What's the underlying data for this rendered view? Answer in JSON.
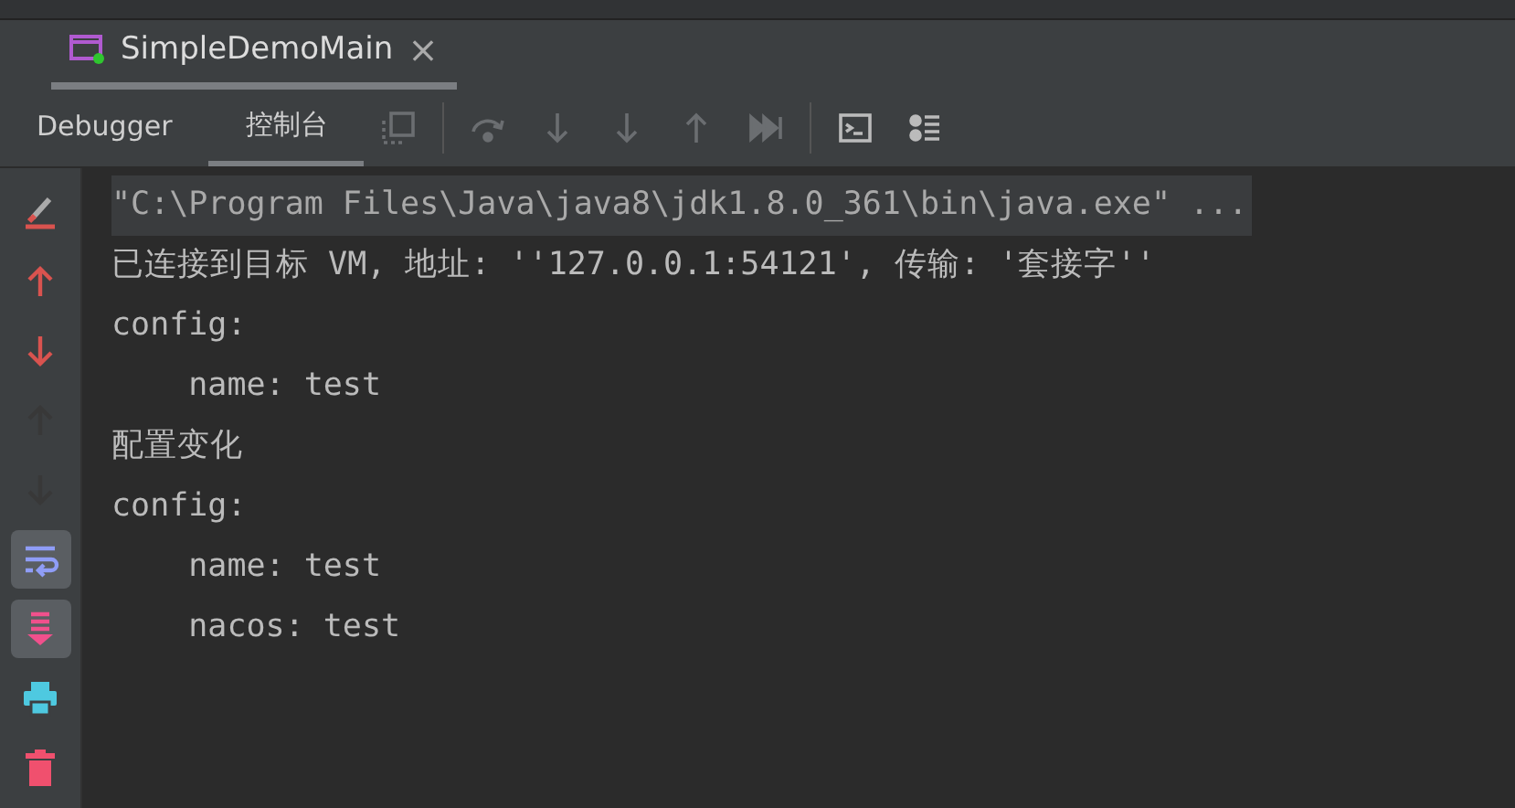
{
  "editor_tabs": [
    {
      "label": "SimpleDemoMain",
      "selected": true,
      "close": "×"
    }
  ],
  "panel_tabs": [
    {
      "label": "Debugger",
      "selected": false
    },
    {
      "label": "控制台",
      "selected": true
    }
  ],
  "toolbar": [
    {
      "kind": "layout",
      "disabled": true
    },
    {
      "kind": "sep"
    },
    {
      "kind": "step-over",
      "disabled": true
    },
    {
      "kind": "step-into",
      "disabled": true
    },
    {
      "kind": "force-step-into",
      "disabled": true
    },
    {
      "kind": "step-out",
      "disabled": true
    },
    {
      "kind": "run-to-cursor",
      "disabled": true
    },
    {
      "kind": "sep"
    },
    {
      "kind": "terminal",
      "disabled": false
    },
    {
      "kind": "list",
      "disabled": false
    }
  ],
  "sidebar": [
    {
      "kind": "clear",
      "disabled": false,
      "toggled": false
    },
    {
      "kind": "up",
      "disabled": false,
      "toggled": false
    },
    {
      "kind": "down",
      "disabled": false,
      "toggled": false
    },
    {
      "kind": "up",
      "disabled": true,
      "toggled": false
    },
    {
      "kind": "down",
      "disabled": true,
      "toggled": false
    },
    {
      "kind": "wrap",
      "disabled": false,
      "toggled": true
    },
    {
      "kind": "scroll",
      "disabled": false,
      "toggled": true
    },
    {
      "kind": "print",
      "disabled": false,
      "toggled": false
    },
    {
      "kind": "trash",
      "disabled": false,
      "toggled": false
    }
  ],
  "console": [
    {
      "kind": "command",
      "text": "\"C:\\Program Files\\Java\\java8\\jdk1.8.0_361\\bin\\java.exe\" ..."
    },
    {
      "kind": "output",
      "text": "已连接到目标 VM, 地址: ''127.0.0.1:54121', 传输: '套接字''"
    },
    {
      "kind": "output",
      "text": "config:"
    },
    {
      "kind": "output",
      "text": "    name: test"
    },
    {
      "kind": "output",
      "text": "配置变化"
    },
    {
      "kind": "output",
      "text": "config:"
    },
    {
      "kind": "output",
      "text": "    name: test"
    },
    {
      "kind": "output",
      "text": "    nacos: test"
    }
  ]
}
